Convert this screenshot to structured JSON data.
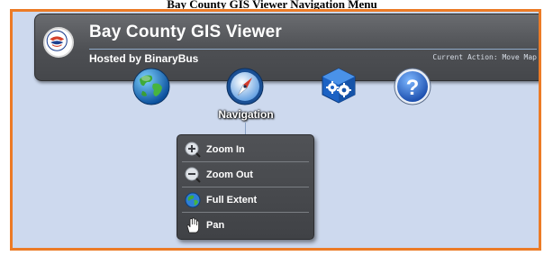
{
  "caption": "Bay County GIS Viewer Navigation Menu",
  "header": {
    "title": "Bay County GIS Viewer",
    "subtitle": "Hosted by BinaryBus",
    "status": "Current Action: Move Map"
  },
  "toolbar": {
    "active_tool_label": "Navigation",
    "tools": [
      "globe-icon",
      "compass-icon",
      "settings-gears-icon",
      "help-icon"
    ]
  },
  "nav_menu": {
    "items": [
      {
        "label": "Zoom In",
        "icon": "zoom-in-icon"
      },
      {
        "label": "Zoom Out",
        "icon": "zoom-out-icon"
      },
      {
        "label": "Full Extent",
        "icon": "globe-small-icon"
      },
      {
        "label": "Pan",
        "icon": "hand-icon"
      }
    ]
  },
  "colors": {
    "accent_border": "#ec7b26",
    "map_background": "#cdd9ee",
    "panel": "#4d4f53"
  }
}
